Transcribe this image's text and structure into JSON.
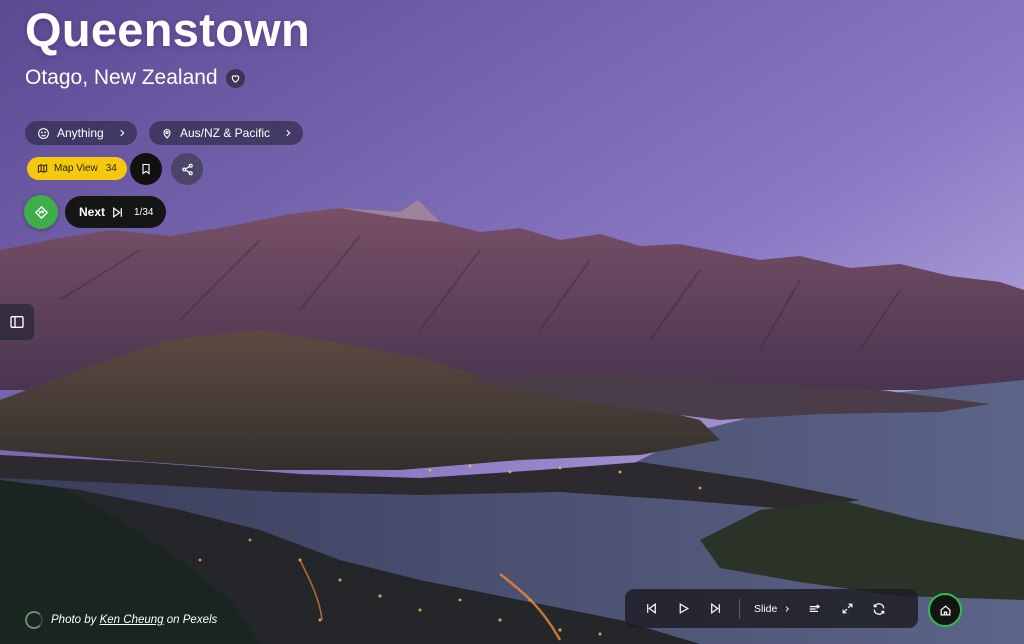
{
  "place": {
    "title": "Queenstown",
    "subtitle": "Otago, New Zealand"
  },
  "filters": {
    "category_label": "Anything",
    "region_label": "Aus/NZ & Pacific"
  },
  "actions": {
    "map_view_label": "Map View",
    "map_view_count": "34",
    "next_label": "Next",
    "next_counter": "1/34"
  },
  "credit": {
    "prefix": "Photo by",
    "author": "Ken Cheung",
    "suffix": "on Pexels"
  },
  "player": {
    "slide_label": "Slide"
  },
  "colors": {
    "map_button": "#f5c810",
    "green_action": "#3fae4a",
    "home_ring": "#2fbf4a",
    "sky_top": "#5e4d98",
    "sky_bottom": "#c9bde6"
  },
  "icons": {
    "favorite": "heart-icon",
    "category": "smiley-icon",
    "region": "location-pin-icon",
    "map": "map-icon",
    "bookmark": "bookmark-icon",
    "share": "share-icon",
    "random": "random-route-icon",
    "next": "skip-next-icon",
    "sidebar": "sidebar-icon",
    "previous_track": "skip-back-icon",
    "play": "play-icon",
    "next_track": "skip-forward-icon",
    "transition": "transition-icon",
    "fullscreen": "fullscreen-icon",
    "refresh": "refresh-icon",
    "home": "home-icon"
  }
}
